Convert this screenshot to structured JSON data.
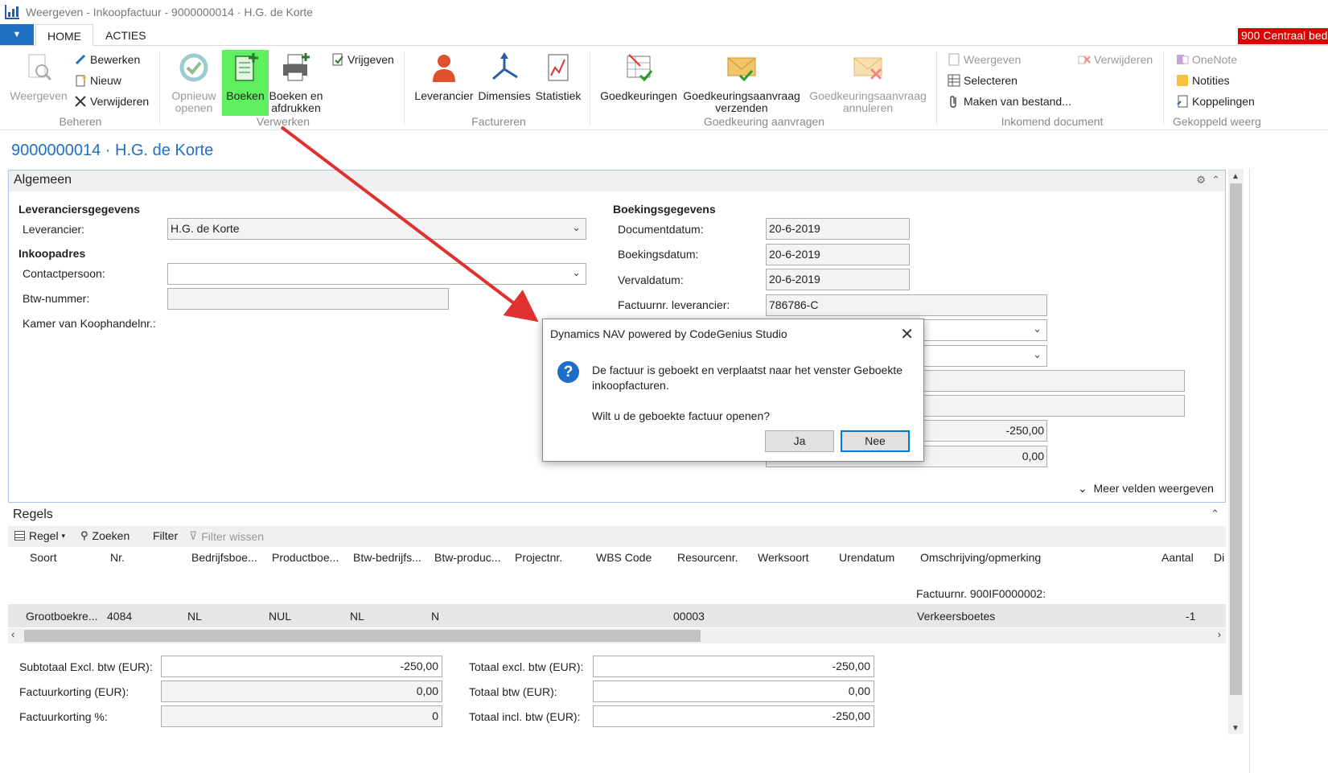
{
  "window": {
    "title": "Weergeven - Inkoopfactuur - 9000000014 · H.G. de Korte"
  },
  "tabs": {
    "home": "HOME",
    "acties": "ACTIES"
  },
  "company_badge": "900 Centraal bed",
  "ribbon": {
    "beheren": {
      "label": "Beheren",
      "weergeven": "Weergeven",
      "bewerken": "Bewerken",
      "nieuw": "Nieuw",
      "verwijderen": "Verwijderen"
    },
    "verwerken": {
      "label": "Verwerken",
      "opnieuw_openen_1": "Opnieuw",
      "opnieuw_openen_2": "openen",
      "boeken": "Boeken",
      "boeken_afdrukken_1": "Boeken en",
      "boeken_afdrukken_2": "afdrukken",
      "vrijgeven": "Vrijgeven"
    },
    "factureren": {
      "label": "Factureren",
      "leverancier": "Leverancier",
      "dimensies": "Dimensies",
      "statistiek": "Statistiek"
    },
    "goedkeuring": {
      "label": "Goedkeuring aanvragen",
      "goedkeuringen": "Goedkeuringen",
      "verzenden_1": "Goedkeuringsaanvraag",
      "verzenden_2": "verzenden",
      "annuleren_1": "Goedkeuringsaanvraag",
      "annuleren_2": "annuleren"
    },
    "inkomend": {
      "label": "Inkomend document",
      "weergeven": "Weergeven",
      "verwijderen": "Verwijderen",
      "selecteren": "Selecteren",
      "maken": "Maken van bestand..."
    },
    "gekoppeld": {
      "label": "Gekoppeld weerg",
      "onenote": "OneNote",
      "notities": "Notities",
      "koppelingen": "Koppelingen"
    }
  },
  "page_title": "9000000014 · H.G. de Korte",
  "algemeen": {
    "header": "Algemeen",
    "leveranciersgegevens": "Leveranciersgegevens",
    "leverancier_label": "Leverancier:",
    "leverancier_value": "H.G. de Korte",
    "inkoopadres": "Inkoopadres",
    "contactpersoon_label": "Contactpersoon:",
    "contactpersoon_value": "",
    "btw_label": "Btw-nummer:",
    "btw_value": "",
    "kvk_label": "Kamer van Koophandelnr.:",
    "boekingsgegevens": "Boekingsgegevens",
    "documentdatum_label": "Documentdatum:",
    "documentdatum": "20-6-2019",
    "boekingsdatum_label": "Boekingsdatum:",
    "boekingsdatum": "20-6-2019",
    "vervaldatum_label": "Vervaldatum:",
    "vervaldatum": "20-6-2019",
    "factuurnr_label": "Factuurnr. leverancier:",
    "factuurnr": "786786-C",
    "amount1": "-250,00",
    "amount2": "0,00",
    "meer_velden": "Meer velden weergeven"
  },
  "dialog": {
    "title": "Dynamics NAV powered by CodeGenius Studio",
    "message": "De factuur is geboekt en verplaatst naar het venster Geboekte inkoopfacturen.",
    "question": "Wilt u de geboekte factuur openen?",
    "ja": "Ja",
    "nee": "Nee"
  },
  "regels": {
    "header": "Regels",
    "toolbar": {
      "regel": "Regel",
      "zoeken": "Zoeken",
      "filter": "Filter",
      "filter_wissen": "Filter wissen"
    },
    "columns": [
      "Soort",
      "Nr.",
      "Bedrijfsboe...",
      "Productboe...",
      "Btw-bedrijfs...",
      "Btw-produc...",
      "Projectnr.",
      "WBS Code",
      "Resourcenr.",
      "Werksoort",
      "Urendatum",
      "Omschrijving/opmerking",
      "Aantal",
      "Di"
    ],
    "description_line": "Factuurnr. 900IF0000002:",
    "row": {
      "soort": "Grootboekre...",
      "nr": "4084",
      "bedrijfsboe": "NL",
      "productboe": "NUL",
      "btw_bedrijfs": "NL",
      "btw_produc": "N",
      "resourcenr": "00003",
      "omschrijving": "Verkeersboetes",
      "aantal": "-1"
    }
  },
  "totals": {
    "subtotaal_label": "Subtotaal Excl. btw (EUR):",
    "subtotaal": "-250,00",
    "factuurkorting_label": "Factuurkorting (EUR):",
    "factuurkorting": "0,00",
    "factuurkorting_pct_label": "Factuurkorting %:",
    "factuurkorting_pct": "0",
    "totaal_excl_label": "Totaal excl. btw (EUR):",
    "totaal_excl": "-250,00",
    "totaal_btw_label": "Totaal btw (EUR):",
    "totaal_btw": "0,00",
    "totaal_incl_label": "Totaal incl. btw (EUR):",
    "totaal_incl": "-250,00"
  },
  "colors": {
    "accent": "#1f6fc5",
    "highlight": "#5ef05e",
    "arrow": "#e03030",
    "company_badge": "#dd0000"
  }
}
